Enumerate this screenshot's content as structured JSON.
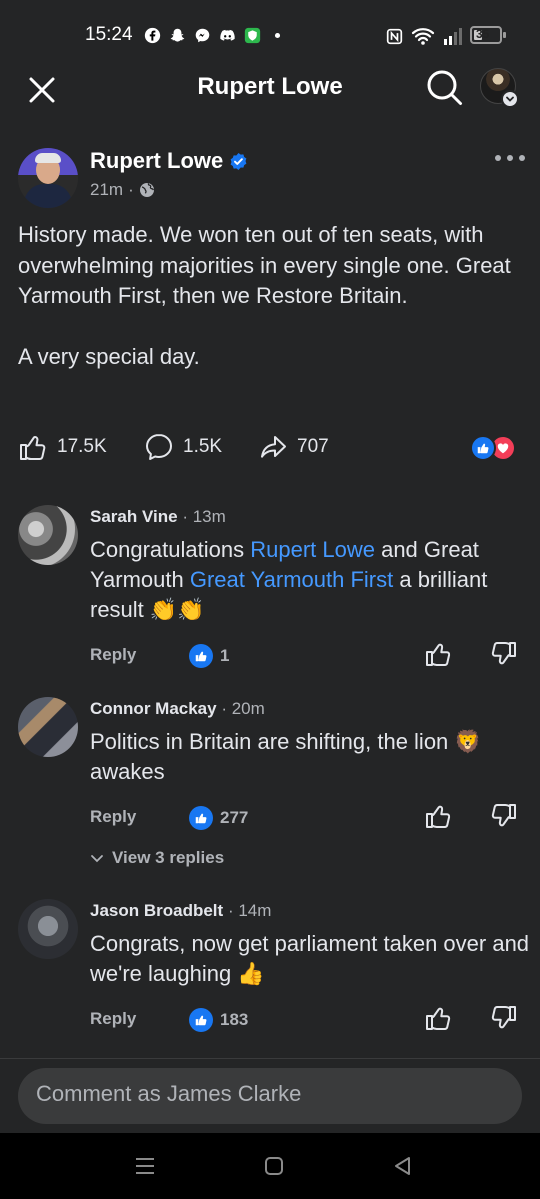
{
  "status": {
    "time": "15:24",
    "battery": "35",
    "battery_level": 0.35
  },
  "header": {
    "title": "Rupert Lowe"
  },
  "post": {
    "author": "Rupert Lowe",
    "time": "21m",
    "separator": "·",
    "text": "History made. We won ten out of ten seats, with overwhelming majorities in every single one. Great Yarmouth First, then we Restore Britain.\n\nA very special day.",
    "likes": "17.5K",
    "comments": "1.5K",
    "shares": "707"
  },
  "comments": [
    {
      "name": "Sarah Vine",
      "time": "· 13m",
      "text_a": "Congratulations ",
      "mention_1": "Rupert Lowe",
      "text_b": " and Great Yarmouth ",
      "mention_2": "Great Yarmouth First",
      "text_c": " a brilliant result 👏👏",
      "reply_label": "Reply",
      "likes": "1"
    },
    {
      "name": "Connor Mackay",
      "time": "· 20m",
      "text": "Politics in Britain are shifting, the lion 🦁 awakes",
      "reply_label": "Reply",
      "likes": "277",
      "view_replies": "View 3 replies"
    },
    {
      "name": "Jason Broadbelt",
      "time": "· 14m",
      "text": "Congrats, now get parliament taken over and we're laughing 👍",
      "reply_label": "Reply",
      "likes": "183"
    }
  ],
  "composer": {
    "placeholder": "Comment as James Clarke"
  },
  "colors": {
    "background": "#242526",
    "accent": "#1877f2",
    "mention": "#4599ff",
    "love": "#f33e58"
  }
}
